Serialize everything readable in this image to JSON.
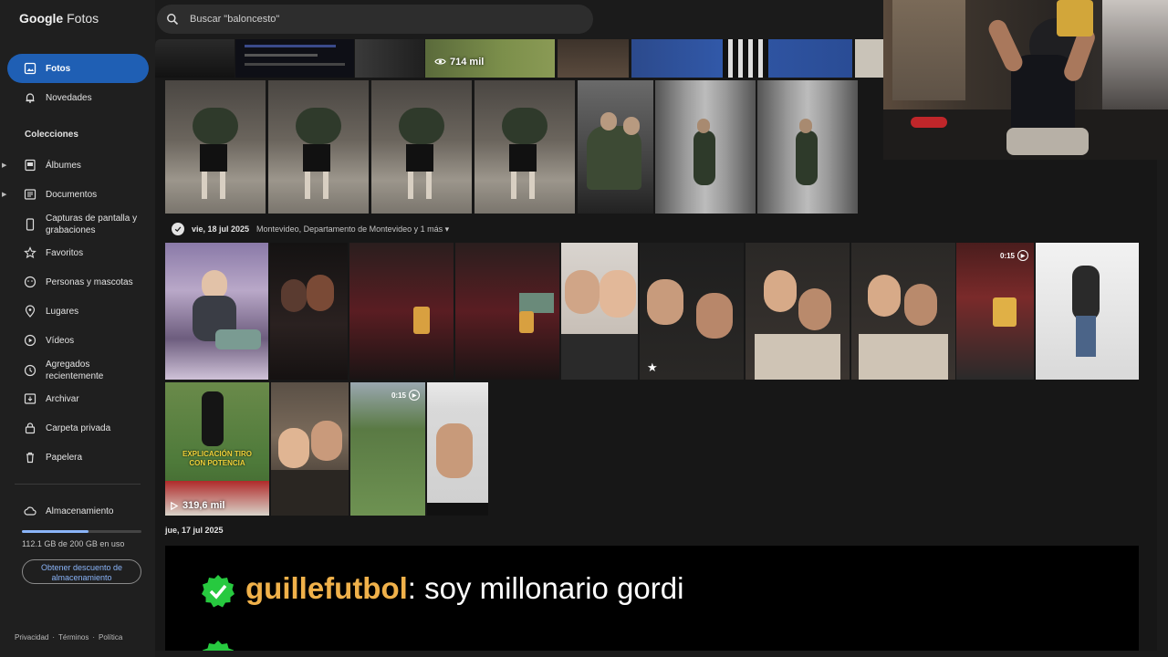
{
  "app": {
    "logo_brand": "Google",
    "logo_product": "Fotos"
  },
  "search": {
    "placeholder": "Buscar \"baloncesto\""
  },
  "sidebar": {
    "primary": [
      {
        "label": "Fotos",
        "icon": "photo-icon",
        "active": true
      },
      {
        "label": "Novedades",
        "icon": "bell-icon"
      }
    ],
    "collections_title": "Colecciones",
    "collections": [
      {
        "label": "Álbumes",
        "icon": "album-icon",
        "expandable": true
      },
      {
        "label": "Documentos",
        "icon": "document-icon",
        "expandable": true
      },
      {
        "label": "Capturas de pantalla y grabaciones",
        "icon": "phone-icon"
      },
      {
        "label": "Favoritos",
        "icon": "star-icon"
      },
      {
        "label": "Personas y mascotas",
        "icon": "face-icon"
      },
      {
        "label": "Lugares",
        "icon": "pin-icon"
      },
      {
        "label": "Vídeos",
        "icon": "video-icon"
      },
      {
        "label": "Agregados recientemente",
        "icon": "clock-icon"
      },
      {
        "label": "Archivar",
        "icon": "archive-icon"
      },
      {
        "label": "Carpeta privada",
        "icon": "lock-icon"
      },
      {
        "label": "Papelera",
        "icon": "trash-icon"
      }
    ],
    "storage": {
      "label": "Almacenamiento",
      "usage_text": "112.1 GB de 200 GB en uso",
      "used_fraction": 0.56,
      "button_label": "Obtener descuento de almacenamiento"
    },
    "footer": [
      "Privacidad",
      "·",
      "Términos",
      "·",
      "Política"
    ]
  },
  "timeline": {
    "group_top": {
      "view_count": "714 mil"
    },
    "group_18": {
      "date": "vie, 18 jul 2025",
      "location": "Montevideo, Departamento de Montevideo y 1 más ▾"
    },
    "video_durations": [
      "0:15",
      "0:15"
    ],
    "reel_views": "319,6 mil",
    "reel_caption": "EXPLICACIÓN TIRO CON POTENCIA",
    "group_17": {
      "date": "jue, 17 jul 2025"
    }
  },
  "banner": {
    "username": "guillefutbol",
    "message": ": soy millonario gordi"
  },
  "colors": {
    "accent": "#1f5fb4",
    "link": "#8ab4f8",
    "verified": "#27c93f",
    "username": "#f0b14a"
  }
}
